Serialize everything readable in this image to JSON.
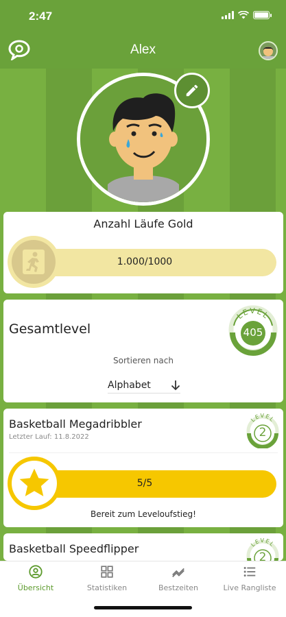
{
  "status": {
    "time": "2:47"
  },
  "header": {
    "title": "Alex"
  },
  "card_runs": {
    "title": "Anzahl Läufe Gold",
    "progress_text": "1.000/1000",
    "progress_fraction": 1.0
  },
  "card_total": {
    "title": "Gesamtlevel",
    "level_label": "LEVEL",
    "level_value": "405",
    "sort_label": "Sortieren nach",
    "sort_value": "Alphabet"
  },
  "skills": [
    {
      "title": "Basketball Megadribbler",
      "last_run": "Letzter Lauf: 11.8.2022",
      "level_label": "LEVEL",
      "level": "2",
      "progress_text": "5/5",
      "progress_fraction": 1.0,
      "status": "Bereit zum Leveloufstieg!"
    },
    {
      "title": "Basketball Speedflipper",
      "level_label": "LEVEL",
      "level": "2"
    }
  ],
  "tabs": [
    {
      "label": "Übersicht",
      "icon": "account-circle-icon",
      "active": true
    },
    {
      "label": "Statistiken",
      "icon": "grid-icon",
      "active": false
    },
    {
      "label": "Bestzeiten",
      "icon": "trend-icon",
      "active": false
    },
    {
      "label": "Live Rangliste",
      "icon": "list-icon",
      "active": false
    }
  ],
  "colors": {
    "green": "#6aa23a",
    "gold": "#f2e6a2",
    "yellow": "#f6c700",
    "accent_text": "#5c9a2c"
  }
}
